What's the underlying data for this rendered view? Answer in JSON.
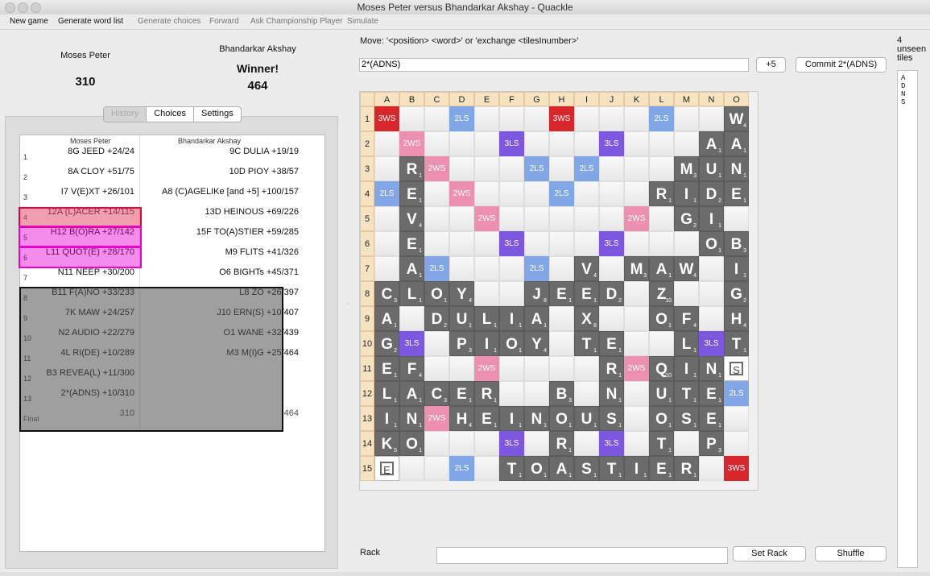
{
  "window": {
    "title": "Moses Peter versus Bhandarkar Akshay - Quackle"
  },
  "toolbar": {
    "items": [
      "New game",
      "Generate word list",
      "Generate choices",
      "Forward",
      "Ask Championship Player",
      "Simulate"
    ]
  },
  "players": {
    "p1": {
      "name": "Moses Peter",
      "score": "310"
    },
    "p2": {
      "name": "Bhandarkar Akshay",
      "status": "Winner!",
      "score": "464"
    }
  },
  "tabs": [
    "History",
    "Choices",
    "Settings"
  ],
  "history": {
    "columns": [
      "Moses Peter",
      "Bhandarkar Akshay"
    ],
    "rows": [
      {
        "n": "1",
        "a": "8G JEED  +24/24",
        "b": "9C DULIA  +19/19"
      },
      {
        "n": "2",
        "a": "8A CLOY  +51/75",
        "b": "10D PIOY  +38/57"
      },
      {
        "n": "3",
        "a": "I7 V(E)XT  +26/101",
        "b": "A8 (C)AGELIKe [and +5]  +100/157"
      },
      {
        "n": "4",
        "a": "12A (L)ACER  +14/115",
        "b": "13D HEINOUS  +69/226"
      },
      {
        "n": "5",
        "a": "H12 B(O)RA  +27/142",
        "b": "15F TO(A)STIER  +59/285"
      },
      {
        "n": "6",
        "a": "L11 QUOT(E)  +28/170",
        "b": "M9 FLITS  +41/326"
      },
      {
        "n": "7",
        "a": "N11 NEEP  +30/200",
        "b": "O6 BIGHTs  +45/371"
      },
      {
        "n": "8",
        "a": "B11 F(A)NO  +33/233",
        "b": "L8 ZO  +26/397"
      },
      {
        "n": "9",
        "a": "7K MAW  +24/257",
        "b": "J10 ERN(S)  +10/407"
      },
      {
        "n": "10",
        "a": "N2 AUDIO  +22/279",
        "b": "O1 WANE  +32/439"
      },
      {
        "n": "11",
        "a": "4L RI(DE)  +10/289",
        "b": "M3 M(I)G  +25/464"
      },
      {
        "n": "12",
        "a": "B3 REVEA(L)  +11/300",
        "b": ""
      },
      {
        "n": "13",
        "a": "2*(ADNS)  +10/310",
        "b": ""
      },
      {
        "n": "Final",
        "a": "310",
        "b": "464"
      }
    ]
  },
  "move": {
    "label": "Move: '<position> <word>' or 'exchange <tilesInumber>'",
    "value": "2*(ADNS)",
    "plus_label": "+5",
    "commit_label": "Commit 2*(ADNS)"
  },
  "board": {
    "cols": [
      "A",
      "B",
      "C",
      "D",
      "E",
      "F",
      "G",
      "H",
      "I",
      "J",
      "K",
      "L",
      "M",
      "N",
      "O"
    ],
    "rows": [
      [
        "3WS",
        "",
        "",
        "2LS",
        "",
        "",
        "",
        "3WS",
        "",
        "",
        "",
        "2LS",
        "",
        "",
        "W"
      ],
      [
        "",
        "2WS",
        "",
        "",
        "",
        "3LS",
        "",
        "",
        "",
        "3LS",
        "",
        "",
        "",
        "A",
        "A"
      ],
      [
        "",
        "R",
        "2WS",
        "",
        "",
        "",
        "2LS",
        "",
        "2LS",
        "",
        "",
        "",
        "M",
        "U",
        "N"
      ],
      [
        "2LS",
        "E",
        "",
        "2WS",
        "",
        "",
        "",
        "2LS",
        "",
        "",
        "",
        "R",
        "I",
        "D",
        "E"
      ],
      [
        "",
        "V",
        "",
        "",
        "2WS",
        "",
        "",
        "",
        "",
        "",
        "2WS",
        "",
        "G",
        "I",
        ""
      ],
      [
        "",
        "E",
        "",
        "",
        "",
        "3LS",
        "",
        "",
        "",
        "3LS",
        "",
        "",
        "",
        "O",
        "B"
      ],
      [
        "",
        "A",
        "2LS",
        "",
        "",
        "",
        "2LS",
        "",
        "V",
        "",
        "M",
        "A",
        "W",
        "",
        "I"
      ],
      [
        "C",
        "L",
        "O",
        "Y",
        "",
        "",
        "J",
        "E",
        "E",
        "D",
        "",
        "Z",
        "",
        "",
        "G"
      ],
      [
        "A",
        "",
        "D",
        "U",
        "L",
        "I",
        "A",
        "",
        "X",
        "",
        "",
        "O",
        "F",
        "",
        "H"
      ],
      [
        "G",
        "3LS",
        "",
        "P",
        "I",
        "O",
        "Y",
        "",
        "T",
        "E",
        "",
        "",
        "L",
        "3LS",
        "T"
      ],
      [
        "E",
        "F",
        "",
        "",
        "2WS",
        "",
        "",
        "",
        "",
        "R",
        "2WS",
        "Q",
        "I",
        "N",
        "s"
      ],
      [
        "L",
        "A",
        "C",
        "E",
        "R",
        "",
        "",
        "B",
        "",
        "N",
        "",
        "U",
        "T",
        "E",
        "2LS"
      ],
      [
        "I",
        "N",
        "2WS",
        "H",
        "E",
        "I",
        "N",
        "O",
        "U",
        "S",
        "",
        "O",
        "S",
        "E",
        ""
      ],
      [
        "K",
        "O",
        "",
        "",
        "",
        "3LS",
        "",
        "R",
        "",
        "3LS",
        "",
        "T",
        "",
        "P",
        ""
      ],
      [
        "e",
        "",
        "",
        "2LS",
        "",
        "T",
        "O",
        "A",
        "S",
        "T",
        "I",
        "E",
        "R",
        "",
        "3WS"
      ]
    ],
    "points": [
      [
        "",
        "",
        "",
        "",
        "",
        "",
        "",
        "",
        "",
        "",
        "",
        "",
        "",
        "",
        "4"
      ],
      [
        "",
        "",
        "",
        "",
        "",
        "",
        "",
        "",
        "",
        "",
        "",
        "",
        "",
        "1",
        "1"
      ],
      [
        "",
        "1",
        "",
        "",
        "",
        "",
        "",
        "",
        "",
        "",
        "",
        "",
        "3",
        "1",
        "1"
      ],
      [
        "",
        "1",
        "",
        "",
        "",
        "",
        "",
        "",
        "",
        "",
        "",
        "1",
        "1",
        "2",
        "1"
      ],
      [
        "",
        "4",
        "",
        "",
        "",
        "",
        "",
        "",
        "",
        "",
        "",
        "",
        "2",
        "1",
        ""
      ],
      [
        "",
        "1",
        "",
        "",
        "",
        "",
        "",
        "",
        "",
        "",
        "",
        "",
        "",
        "1",
        "3"
      ],
      [
        "",
        "1",
        "",
        "",
        "",
        "",
        "",
        "",
        "4",
        "",
        "3",
        "1",
        "4",
        "",
        "1"
      ],
      [
        "3",
        "1",
        "1",
        "4",
        "",
        "",
        "8",
        "1",
        "1",
        "2",
        "",
        "10",
        "",
        "",
        "2"
      ],
      [
        "1",
        "",
        "2",
        "1",
        "1",
        "1",
        "1",
        "",
        "8",
        "",
        "",
        "1",
        "4",
        "",
        "4"
      ],
      [
        "2",
        "",
        "",
        "3",
        "1",
        "1",
        "4",
        "",
        "1",
        "1",
        "",
        "",
        "1",
        "",
        "1"
      ],
      [
        "1",
        "4",
        "",
        "",
        "",
        "",
        "",
        "",
        "",
        "1",
        "",
        "10",
        "1",
        "1",
        ""
      ],
      [
        "1",
        "1",
        "3",
        "1",
        "1",
        "",
        "",
        "3",
        "",
        "1",
        "",
        "1",
        "1",
        "1",
        ""
      ],
      [
        "1",
        "1",
        "",
        "4",
        "1",
        "1",
        "1",
        "1",
        "1",
        "1",
        "",
        "1",
        "1",
        "1",
        ""
      ],
      [
        "5",
        "1",
        "",
        "",
        "",
        "",
        "",
        "1",
        "",
        "",
        "",
        "1",
        "",
        "3",
        ""
      ],
      [
        "",
        "",
        "",
        "",
        "",
        "1",
        "1",
        "1",
        "1",
        "1",
        "1",
        "1",
        "1",
        "",
        ""
      ]
    ],
    "highlight": [
      [
        7,
        2
      ],
      [
        7,
        3
      ],
      [
        7,
        4
      ],
      [
        10,
        14
      ]
    ]
  },
  "unseen": {
    "count": "4",
    "label_lines": [
      "unseen",
      "tiles"
    ],
    "tiles": [
      "A",
      "D",
      "N",
      "S"
    ]
  },
  "rack": {
    "label": "Rack",
    "value": "",
    "set_label": "Set Rack",
    "shuffle_label": "Shuffle"
  }
}
